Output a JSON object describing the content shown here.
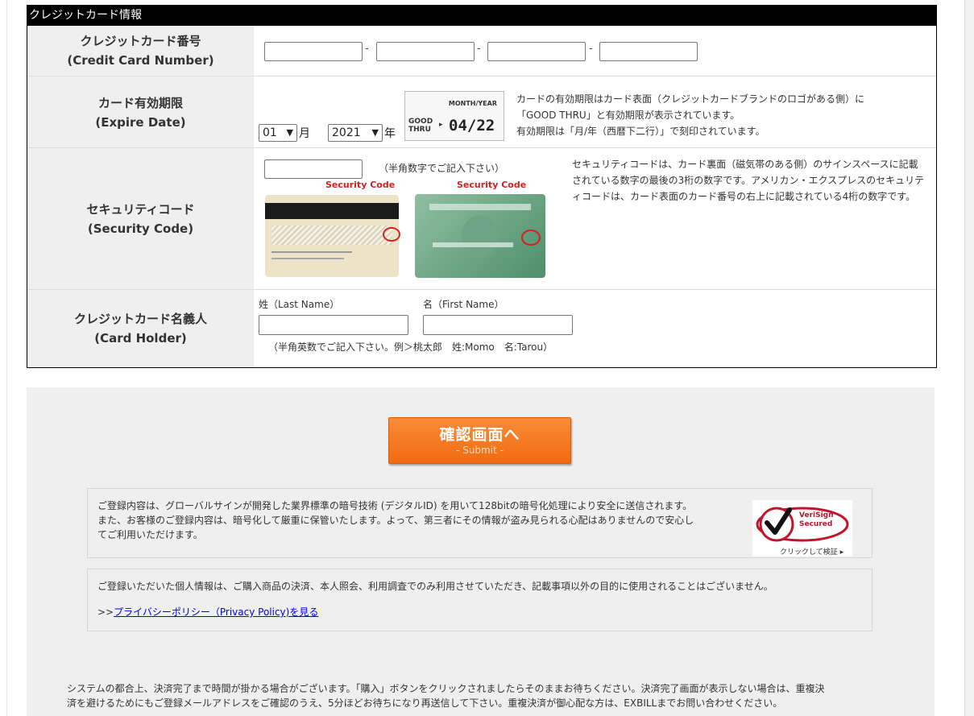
{
  "section": {
    "title": "クレジットカード情報"
  },
  "card_number": {
    "label_jp": "クレジットカード番号",
    "label_en": "(Credit Card Number)",
    "separator": "-"
  },
  "expire": {
    "label_jp": "カード有効期限",
    "label_en": "(Expire Date)",
    "month_value": "01",
    "month_unit": "月",
    "year_value": "2021",
    "year_unit": "年",
    "sample": {
      "month_year": "MONTH/YEAR",
      "good": "GOOD",
      "thru": "THRU",
      "date": "04/22"
    },
    "note1": "カードの有効期限はカード表面（クレジットカードブランドのロゴがある側）に",
    "note2": "「GOOD THRU」と有効期限が表示されています。",
    "note3": "有効期限は「月/年（西暦下二行）」で刻印されています。"
  },
  "security": {
    "label_jp": "セキュリティコード",
    "label_en": "(Security Code)",
    "hint": "（半角数字でご記入下さい）",
    "image_label": "Security Code",
    "note": "セキュリティコードは、カード裏面（磁気帯のある側）のサインスペースに記載されている数字の最後の3桁の数字です。アメリカン・エクスプレスのセキュリティコードは、カード表面のカード番号の右上に記載されている4桁の数字です。"
  },
  "holder": {
    "label_jp": "クレジットカード名義人",
    "label_en": "(Card Holder)",
    "last_name_label": "姓（Last Name）",
    "first_name_label": "名（First Name）",
    "hint": "（半角英数でご記入下さい。例＞桃太郎　姓:Momo　名:Tarou）"
  },
  "submit": {
    "label_jp": "確認画面へ",
    "label_en": "- Submit -"
  },
  "ssl_info": {
    "line1": "ご登録内容は、グローバルサインが開発した業界標準の暗号技術 (デジタルID) を用いて128bitの暗号化処理により安全に送信されます。",
    "line2": "また、お客様のご登録内容は、暗号化して厳重に保管いたします。よって、第三者にその情報が盗み見られる心配はありませんので安心し",
    "line3": "てご利用いただけます。",
    "badge_line1": "VeriSign",
    "badge_line2": "Secured",
    "badge_caption": "クリックして検証 ▸"
  },
  "privacy": {
    "text": "ご登録いただいた個人情報は、ご購入商品の決済、本人照会、利用調査でのみ利用させていただき、記載事項以外の目的に使用されることはございません。",
    "link_prefix": ">>",
    "link_text": "プライバシーポリシー（Privacy Policy)を見る"
  },
  "bottom_note": {
    "line1": "システムの都合上、決済完了まで時間が掛かる場合がございます。「購入」ボタンをクリックされましたらそのままお待ちください。決済完了画面が表示しない場合は、重複決",
    "line2": "済を避けるためにもご登録メールアドレスをご確認のうえ、5分ほどお待ちになり再送信して下さい。重複決済が御心配な方は、EXBILLまでお問い合わせください。"
  },
  "colors": {
    "header_bg": "#000000",
    "label_bg": "#efefef",
    "button": "#f26a10",
    "link": "#0000ee",
    "verisign_red": "#c0152c"
  }
}
